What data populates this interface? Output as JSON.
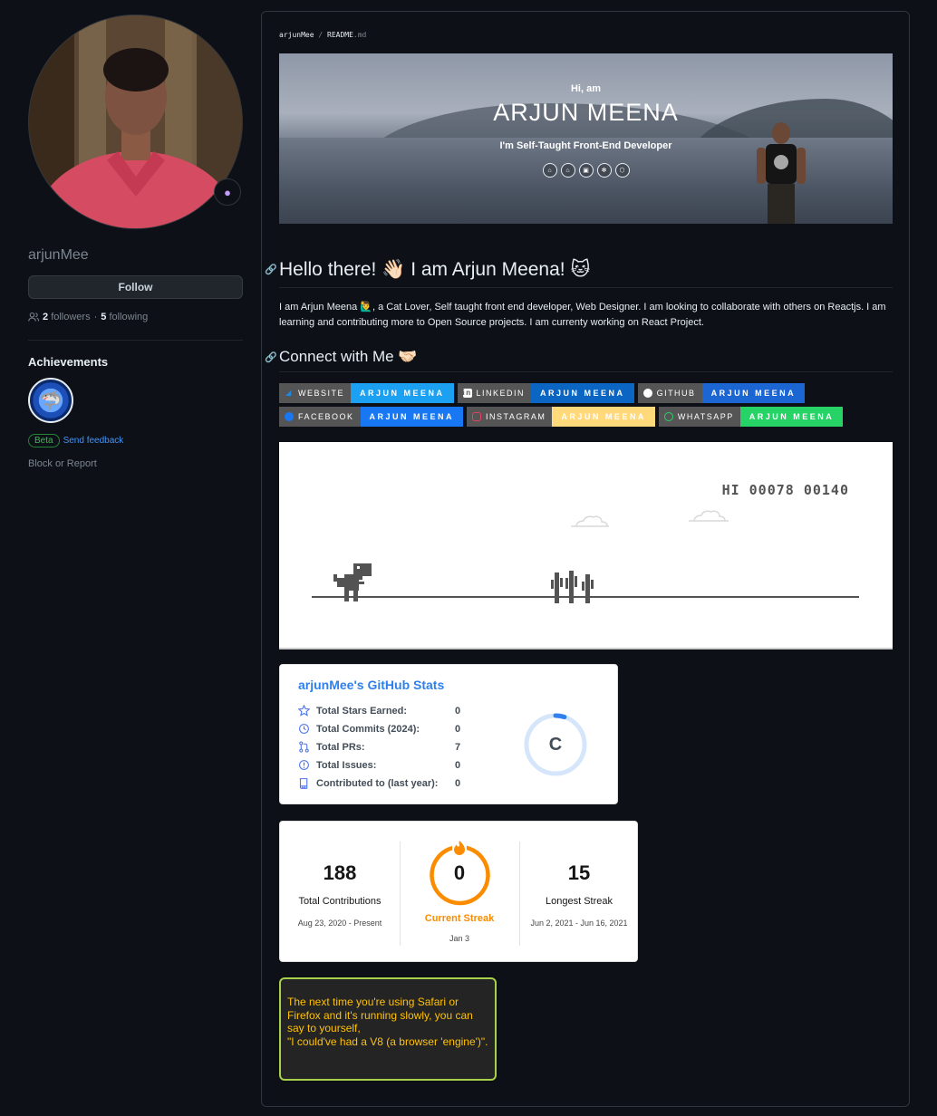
{
  "profile": {
    "username": "arjunMee",
    "follow_label": "Follow",
    "followers_count": "2",
    "followers_label": "followers",
    "following_count": "5",
    "following_label": "following",
    "achievements_title": "Achievements",
    "beta_label": "Beta",
    "send_feedback_label": "Send feedback",
    "block_report_label": "Block or Report"
  },
  "readme": {
    "crumb_user": "arjunMee",
    "crumb_sep": "/",
    "crumb_file": "README",
    "crumb_ext": ".md",
    "banner": {
      "hi": "Hi, am",
      "name": "ARJUN MEENA",
      "role": "I'm Self-Taught Front-End Developer",
      "icons": [
        "html5-icon",
        "css3-icon",
        "js-icon",
        "react-icon",
        "nodejs-icon"
      ]
    },
    "heading1": "Hello there! 👋🏻 I am Arjun Meena! 🐱",
    "intro": "I am Arjun Meena 🙋‍♂️, a Cat Lover, Self taught front end developer, Web Designer. I am looking to collaborate with others on Reactjs. I am learning and contributing more to Open Source projects. I am currenty working on React Project.",
    "heading2": "Connect with Me 🤝🏻",
    "badges": [
      {
        "label": "WEBSITE",
        "value": "ARJUN MEENA",
        "color": "#1ca0f1",
        "icon_color": "#1e88e5"
      },
      {
        "label": "LINKEDIN",
        "value": "ARJUN MEENA",
        "color": "#0a66c2",
        "icon_color": "#ffffff"
      },
      {
        "label": "GITHUB",
        "value": "ARJUN MEENA",
        "color": "#1b66d2",
        "icon_color": "#ffffff"
      },
      {
        "label": "FACEBOOK",
        "value": "ARJUN MEENA",
        "color": "#1877f2",
        "icon_color": "#1877f2"
      },
      {
        "label": "INSTAGRAM",
        "value": "ARJUN MEENA",
        "color": "#ffd97a",
        "icon_color": "#e4405f"
      },
      {
        "label": "WHATSAPP",
        "value": "ARJUN MEENA",
        "color": "#25d366",
        "icon_color": "#25d366"
      }
    ],
    "dino_score": "HI 00078 00140"
  },
  "stats_card": {
    "title": "arjunMee's GitHub Stats",
    "rows": [
      {
        "label": "Total Stars Earned:",
        "value": "0",
        "icon": "star-icon"
      },
      {
        "label": "Total Commits (2024):",
        "value": "0",
        "icon": "history-icon"
      },
      {
        "label": "Total PRs:",
        "value": "7",
        "icon": "pull-request-icon"
      },
      {
        "label": "Total Issues:",
        "value": "0",
        "icon": "issue-icon"
      },
      {
        "label": "Contributed to (last year):",
        "value": "0",
        "icon": "repo-icon"
      }
    ],
    "grade": "C",
    "grade_progress": 0.05
  },
  "streak_card": {
    "total_num": "188",
    "total_label": "Total Contributions",
    "total_range": "Aug 23, 2020 - Present",
    "current_num": "0",
    "current_label": "Current Streak",
    "current_range": "Jan 3",
    "longest_num": "15",
    "longest_label": "Longest Streak",
    "longest_range": "Jun 2, 2021 - Jun 16, 2021"
  },
  "quote": {
    "line1": "The next time you're using Safari or Firefox and it's running slowly, you can say to yourself,",
    "line2": "\"I could've had a V8 (a browser 'engine')\"."
  }
}
